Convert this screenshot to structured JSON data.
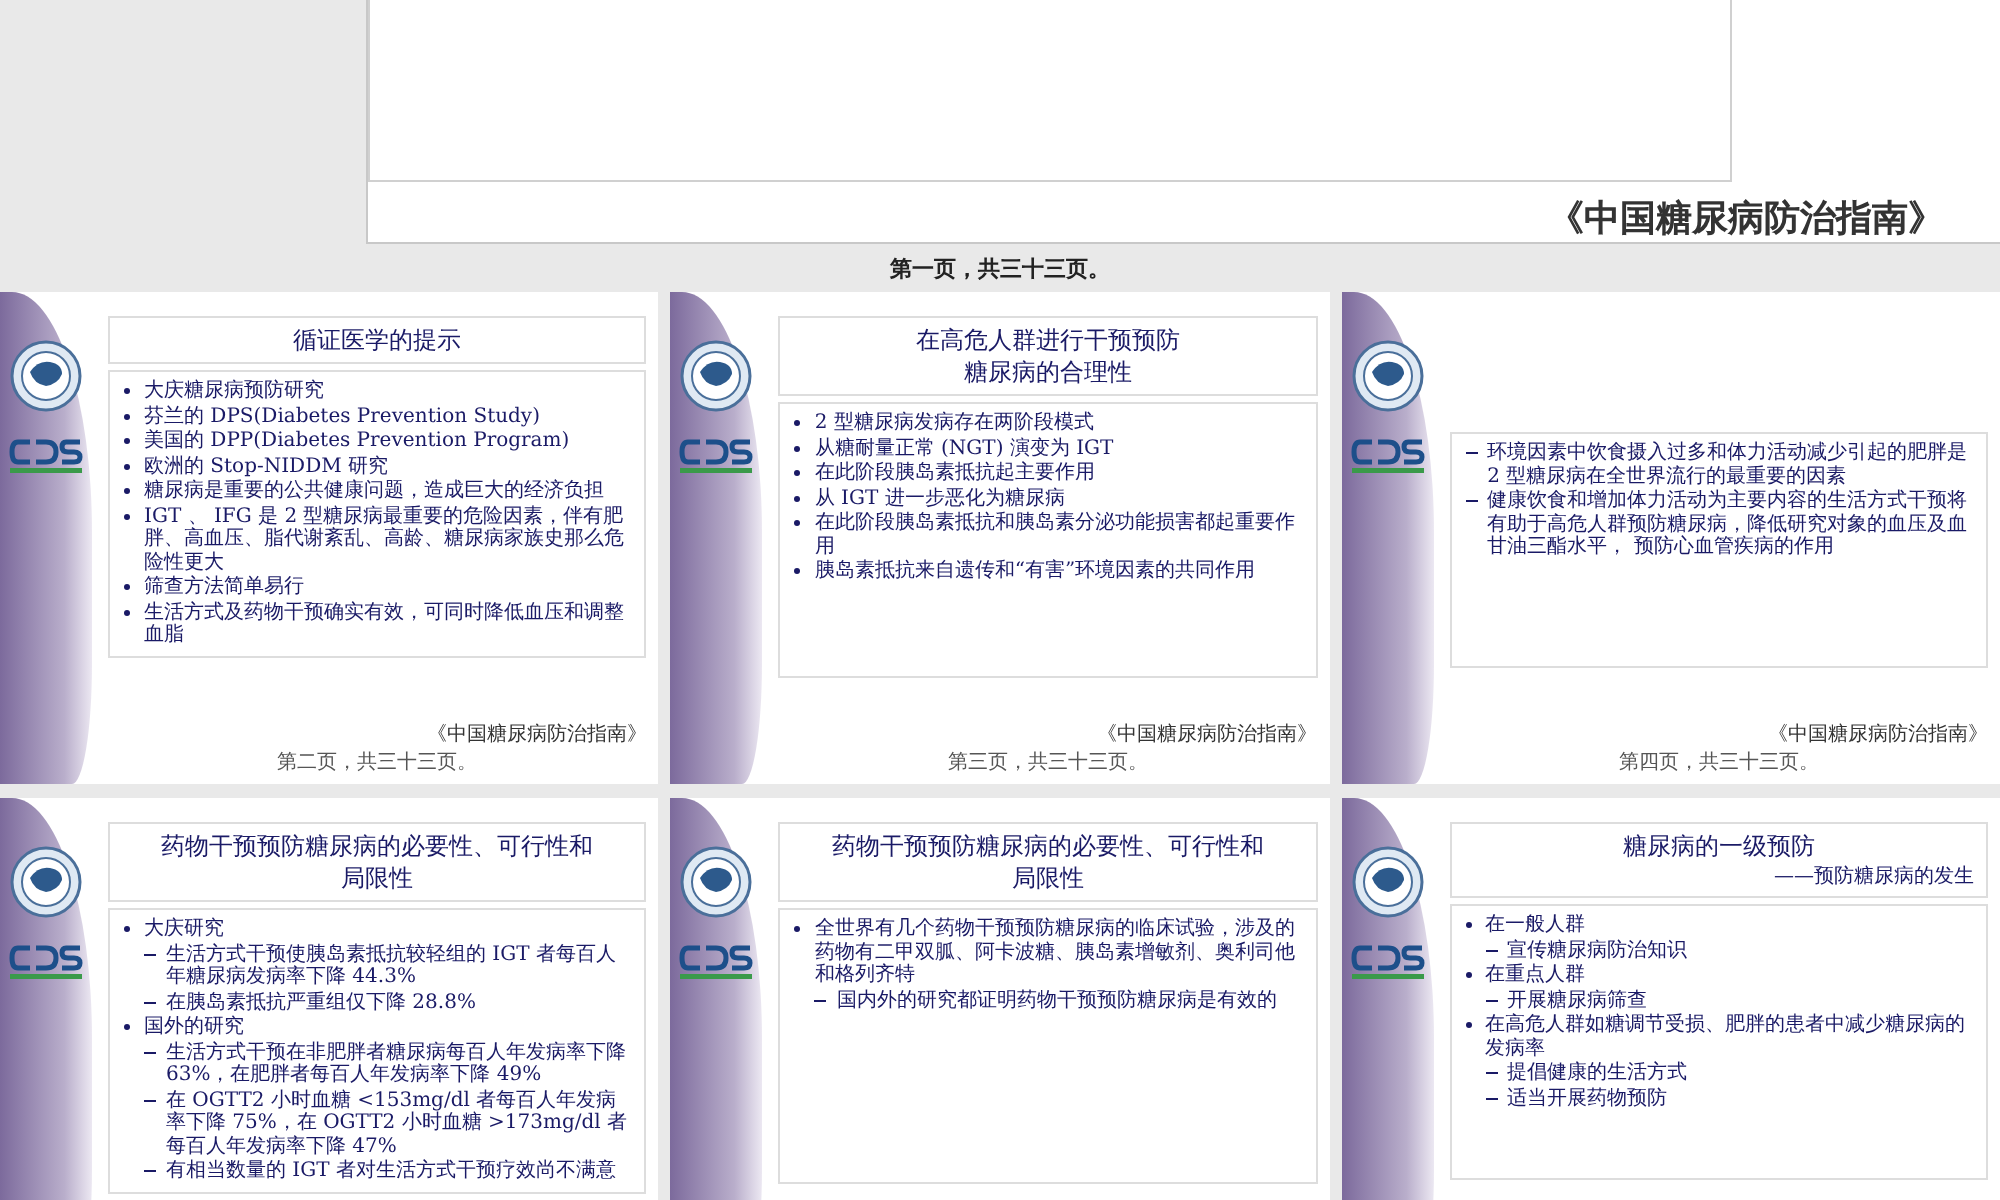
{
  "top_slide": {
    "footer": "《中国糖尿病防治指南》"
  },
  "top_caption": "第一页，共三十三页。",
  "slides": [
    {
      "title": [
        "循证医学的提示"
      ],
      "items": [
        {
          "kind": "bullet",
          "text": "大庆糖尿病预防研究"
        },
        {
          "kind": "bullet",
          "text": "芬兰的 DPS(Diabetes Prevention Study)"
        },
        {
          "kind": "bullet",
          "text": "美国的 DPP(Diabetes Prevention Program)"
        },
        {
          "kind": "bullet",
          "text": "欧洲的  Stop-NIDDM 研究"
        },
        {
          "kind": "bullet",
          "text": "糖尿病是重要的公共健康问题，造成巨大的经济负担"
        },
        {
          "kind": "bullet",
          "text": "IGT 、 IFG 是 2 型糖尿病最重要的危险因素，伴有肥胖、高血压、脂代谢紊乱、高龄、糖尿病家族史那么危险性更大"
        },
        {
          "kind": "bullet",
          "text": "筛查方法简单易行"
        },
        {
          "kind": "bullet",
          "text": "生活方式及药物干预确实有效，可同时降低血压和调整血脂"
        }
      ],
      "footer": "《中国糖尿病防治指南》",
      "caption": "第二页，共三十三页。"
    },
    {
      "title": [
        "在高危人群进行干预预防",
        "糖尿病的合理性"
      ],
      "items": [
        {
          "kind": "bullet",
          "text": "2 型糖尿病发病存在两阶段模式"
        },
        {
          "kind": "bullet",
          "text": "从糖耐量正常 (NGT) 演变为 IGT"
        },
        {
          "kind": "bullet",
          "text": "在此阶段胰岛素抵抗起主要作用"
        },
        {
          "kind": "bullet",
          "text": "从 IGT 进一步恶化为糖尿病"
        },
        {
          "kind": "bullet",
          "text": "在此阶段胰岛素抵抗和胰岛素分泌功能损害都起重要作用"
        },
        {
          "kind": "bullet",
          "text": "胰岛素抵抗来自遗传和“有害”环境因素的共同作用"
        }
      ],
      "footer": "《中国糖尿病防治指南》",
      "caption": "第三页，共三十三页。"
    },
    {
      "items": [
        {
          "kind": "dash",
          "text": "环境因素中饮食摄入过多和体力活动减少引起的肥胖是 2 型糖尿病在全世界流行的最重要的因素"
        },
        {
          "kind": "dash",
          "text": "健康饮食和增加体力活动为主要内容的生活方式干预将有助于高危人群预防糖尿病，降低研究对象的血压及血甘油三酯水平， 预防心血管疾病的作用"
        }
      ],
      "footer": "《中国糖尿病防治指南》",
      "caption": "第四页，共三十三页。"
    },
    {
      "title": [
        "药物干预预防糖尿病的必要性、可行性和",
        "局限性"
      ],
      "items": [
        {
          "kind": "bullet",
          "text": "大庆研究",
          "children": [
            {
              "kind": "dash",
              "text": "生活方式干预使胰岛素抵抗较轻组的 IGT 者每百人年糖尿病发病率下降 44.3%"
            },
            {
              "kind": "dash",
              "text": "在胰岛素抵抗严重组仅下降 28.8%"
            }
          ]
        },
        {
          "kind": "bullet",
          "text": "国外的研究",
          "children": [
            {
              "kind": "dash",
              "text": "生活方式干预在非肥胖者糖尿病每百人年发病率下降 63%，在肥胖者每百人年发病率下降 49%"
            },
            {
              "kind": "dash",
              "text": "在 OGTT2 小时血糖 <153mg/dl 者每百人年发病率下降 75%，在 OGTT2 小时血糖 >173mg/dl 者每百人年发病率下降 47%"
            },
            {
              "kind": "dash",
              "text": "有相当数量的 IGT 者对生活方式干预疗效尚不满意"
            }
          ]
        }
      ]
    },
    {
      "title": [
        "药物干预预防糖尿病的必要性、可行性和",
        "局限性"
      ],
      "items": [
        {
          "kind": "bullet",
          "text": "全世界有几个药物干预预防糖尿病的临床试验，涉及的药物有二甲双胍、阿卡波糖、胰岛素增敏剂、奥利司他和格列齐特",
          "children": [
            {
              "kind": "dash",
              "text": "国内外的研究都证明药物干预预防糖尿病是有效的"
            }
          ]
        }
      ]
    },
    {
      "title": [
        "糖尿病的一级预防"
      ],
      "subtitle": "——预防糖尿病的发生",
      "items": [
        {
          "kind": "bullet",
          "text": "在一般人群",
          "children": [
            {
              "kind": "dash",
              "text": "宣传糖尿病防治知识"
            }
          ]
        },
        {
          "kind": "bullet",
          "text": "在重点人群",
          "children": [
            {
              "kind": "dash",
              "text": "开展糖尿病筛查"
            }
          ]
        },
        {
          "kind": "bullet",
          "text": "在高危人群如糖调节受损、肥胖的患者中减少糖尿病的发病率",
          "children": [
            {
              "kind": "dash",
              "text": "提倡健康的生活方式"
            },
            {
              "kind": "dash",
              "text": "适当开展药物预防"
            }
          ]
        }
      ]
    }
  ]
}
